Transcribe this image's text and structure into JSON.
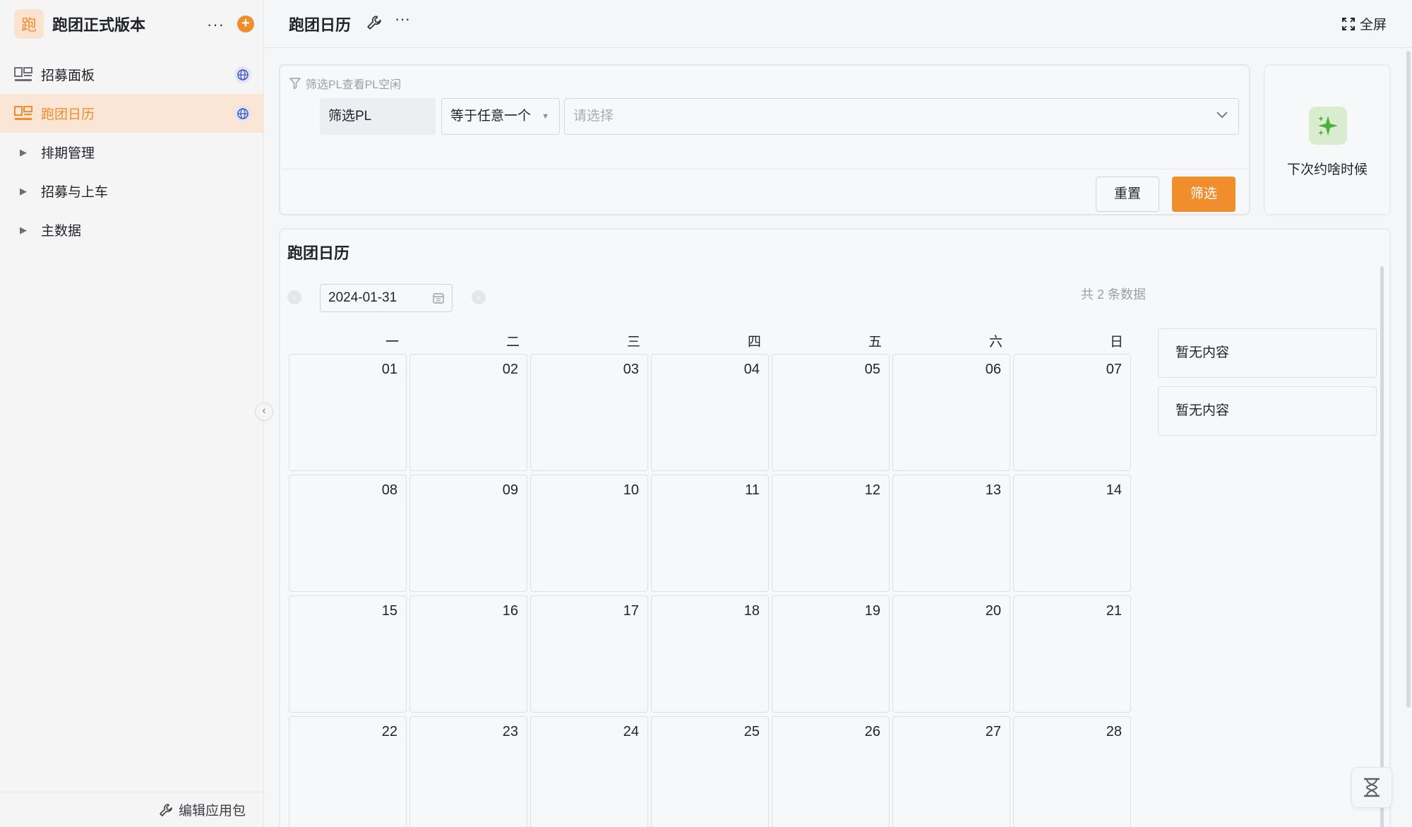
{
  "app": {
    "logo_char": "跑",
    "title": "跑团正式版本",
    "more": "···",
    "add": "+"
  },
  "sidebar": {
    "items": [
      {
        "label": "招募面板"
      },
      {
        "label": "跑团日历"
      },
      {
        "label": "排期管理"
      },
      {
        "label": "招募与上车"
      },
      {
        "label": "主数据"
      }
    ],
    "footer_label": "编辑应用包"
  },
  "topbar": {
    "title": "跑团日历",
    "more": "···",
    "fullscreen": "全屏"
  },
  "filter": {
    "hint": "筛选PL查看PL空闲",
    "field": "筛选PL",
    "operator": "等于任意一个",
    "value_placeholder": "请选择",
    "reset": "重置",
    "submit": "筛选"
  },
  "next_card": {
    "label": "下次约啥时候"
  },
  "calendar": {
    "title": "跑团日历",
    "date": "2024-01-31",
    "count": "共 2 条数据",
    "weekdays": [
      "一",
      "二",
      "三",
      "四",
      "五",
      "六",
      "日"
    ],
    "days": [
      "01",
      "02",
      "03",
      "04",
      "05",
      "06",
      "07",
      "08",
      "09",
      "10",
      "11",
      "12",
      "13",
      "14",
      "15",
      "16",
      "17",
      "18",
      "19",
      "20",
      "21",
      "22",
      "23",
      "24",
      "25",
      "26",
      "27",
      "28"
    ],
    "side_items": [
      "暂无内容",
      "暂无内容"
    ]
  },
  "colors": {
    "accent": "#f08d2c",
    "active_bg": "#fbe6d6",
    "success": "#4caf3a"
  }
}
